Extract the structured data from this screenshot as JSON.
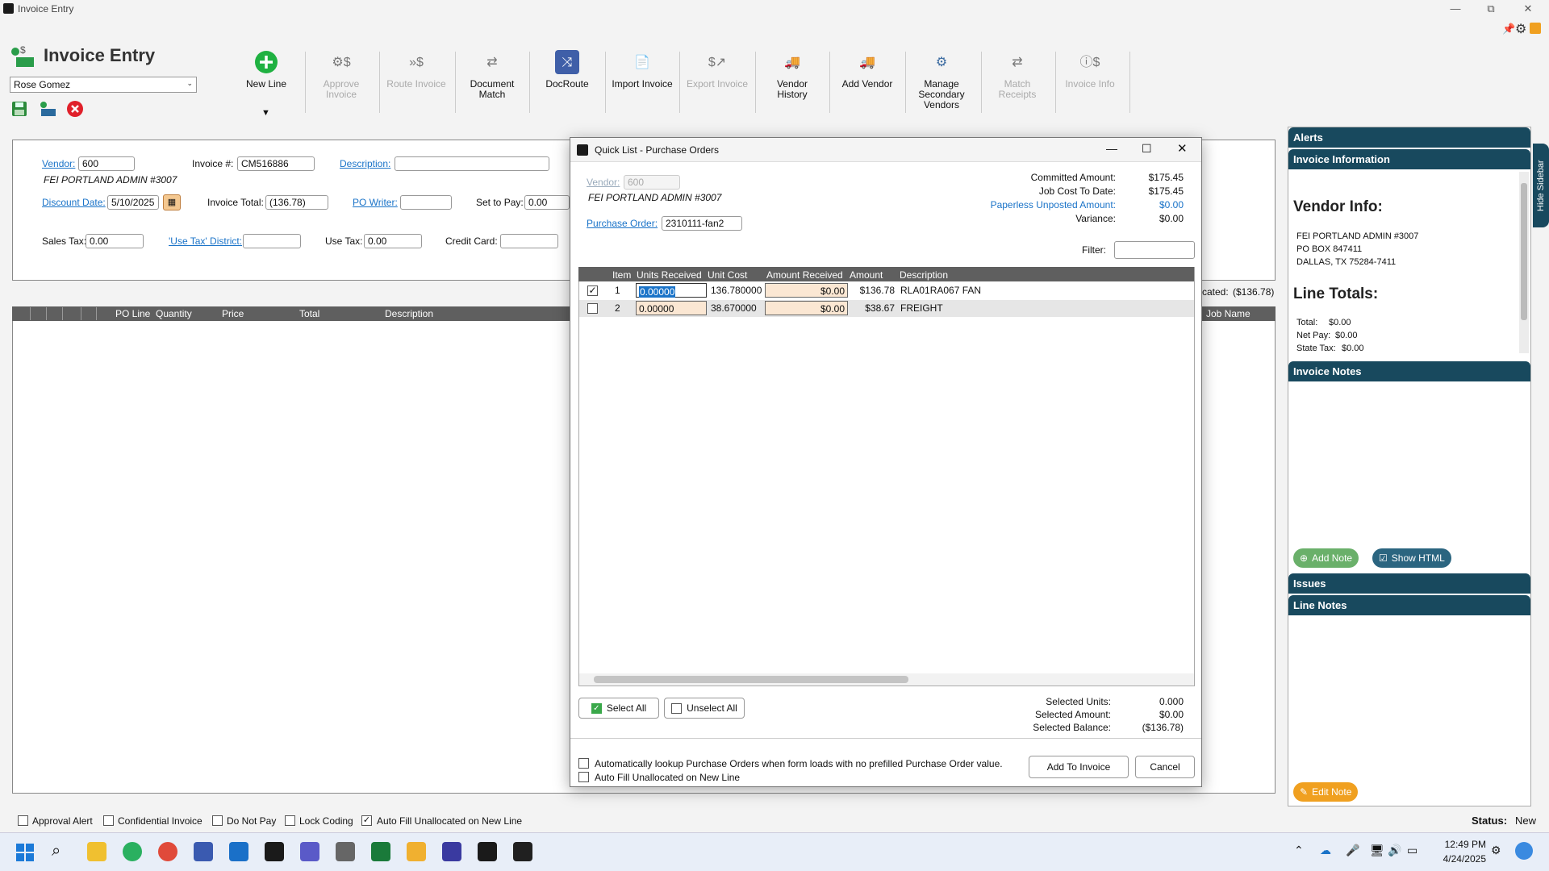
{
  "window": {
    "title": "Invoice Entry",
    "min": "—",
    "max": "⧉",
    "close": "✕"
  },
  "app": {
    "name": "Invoice Entry",
    "user": "Rose Gomez"
  },
  "toolbar": [
    {
      "id": "new-line",
      "label": "New Line",
      "enabled": true
    },
    {
      "id": "approve-invoice",
      "label": "Approve Invoice",
      "enabled": false
    },
    {
      "id": "route-invoice",
      "label": "Route Invoice",
      "enabled": false
    },
    {
      "id": "document-match",
      "label": "Document Match",
      "enabled": true
    },
    {
      "id": "docroute",
      "label": "DocRoute",
      "enabled": true
    },
    {
      "id": "import-invoice",
      "label": "Import Invoice",
      "enabled": true
    },
    {
      "id": "export-invoice",
      "label": "Export Invoice",
      "enabled": false
    },
    {
      "id": "vendor-history",
      "label": "Vendor History",
      "enabled": true
    },
    {
      "id": "add-vendor",
      "label": "Add Vendor",
      "enabled": true
    },
    {
      "id": "manage-secondary-vendors",
      "label": "Manage Secondary Vendors",
      "enabled": true
    },
    {
      "id": "match-receipts",
      "label": "Match Receipts",
      "enabled": false
    },
    {
      "id": "invoice-info",
      "label": "Invoice Info",
      "enabled": false
    }
  ],
  "newline_dropdown": "▼",
  "form": {
    "vendor_label": "Vendor:",
    "vendor_value": "600",
    "vendor_name": "FEI PORTLAND ADMIN #3007",
    "invoice_no_label": "Invoice #:",
    "invoice_no_value": "CM516886",
    "description_label": "Description:",
    "description_value": "",
    "discount_date_label": "Discount Date:",
    "discount_date_value": "5/10/2025",
    "invoice_total_label": "Invoice Total:",
    "invoice_total_value": "(136.78)",
    "po_writer_label": "PO Writer:",
    "po_writer_value": "",
    "set_to_pay_label": "Set to Pay:",
    "set_to_pay_value": "0.00",
    "sales_tax_label": "Sales Tax:",
    "sales_tax_value": "0.00",
    "use_tax_district_label": "'Use Tax' District:",
    "use_tax_district_value": "",
    "use_tax_label": "Use Tax:",
    "use_tax_value": "0.00",
    "credit_card_label": "Credit Card:",
    "credit_card_value": ""
  },
  "allocated_text": "cated:",
  "allocated_value": "($136.78)",
  "lines_grid": {
    "columns": [
      "PO Line",
      "Quantity",
      "Price",
      "Total",
      "Description"
    ],
    "right_column": "Job Name"
  },
  "dialog": {
    "title": "Quick List - Purchase Orders",
    "vendor_label": "Vendor:",
    "vendor_value": "600",
    "vendor_name": "FEI PORTLAND ADMIN #3007",
    "po_label": "Purchase Order:",
    "po_value": "2310111-fan2",
    "committed_label": "Committed Amount:",
    "committed_value": "$175.45",
    "jobcost_label": "Job Cost To Date:",
    "jobcost_value": "$175.45",
    "paperless_label": "Paperless Unposted Amount:",
    "paperless_value": "$0.00",
    "variance_label": "Variance:",
    "variance_value": "$0.00",
    "filter_label": "Filter:",
    "filter_value": "",
    "columns": [
      "Item",
      "Units Received",
      "Unit Cost",
      "Amount Received",
      "Amount",
      "Description"
    ],
    "rows": [
      {
        "checked": true,
        "item": "1",
        "units": "0.00000",
        "unit_cost": "136.780000",
        "amount_received": "$0.00",
        "amount": "$136.78",
        "description": "RLA01RA067 FAN"
      },
      {
        "checked": false,
        "item": "2",
        "units": "0.00000",
        "unit_cost": "38.670000",
        "amount_received": "$0.00",
        "amount": "$38.67",
        "description": "FREIGHT"
      }
    ],
    "select_all": "Select All",
    "unselect_all": "Unselect All",
    "sel_units_label": "Selected Units:",
    "sel_units_value": "0.000",
    "sel_amount_label": "Selected Amount:",
    "sel_amount_value": "$0.00",
    "sel_balance_label": "Selected Balance:",
    "sel_balance_value": "($136.78)",
    "auto_lookup": "Automatically lookup Purchase Orders when form loads with no prefilled Purchase Order value.",
    "auto_fill": "Auto Fill Unallocated on New Line",
    "add_to_invoice": "Add To Invoice",
    "cancel": "Cancel"
  },
  "sidebar": {
    "alerts": "Alerts",
    "invoice_information": "Invoice Information",
    "vendor_info_title": "Vendor Info:",
    "vendor_lines": [
      "FEI PORTLAND ADMIN #3007",
      "PO BOX 847411",
      "DALLAS, TX 75284-7411"
    ],
    "line_totals_title": "Line Totals:",
    "total_label": "Total:",
    "total_value": "$0.00",
    "netpay_label": "Net Pay:",
    "netpay_value": "$0.00",
    "statetax_label": "State Tax:",
    "statetax_value": "$0.00",
    "invoice_notes": "Invoice Notes",
    "add_note": "Add Note",
    "show_html": "Show HTML",
    "issues": "Issues",
    "line_notes": "Line Notes",
    "edit_note": "Edit Note",
    "hide_sidebar": "Hide Sidebar"
  },
  "bottom": {
    "approval_alert": "Approval Alert",
    "confidential_invoice": "Confidential Invoice",
    "do_not_pay": "Do Not Pay",
    "lock_coding": "Lock Coding",
    "auto_fill": "Auto Fill Unallocated on New Line",
    "status_label": "Status:",
    "status_value": "New"
  },
  "taskbar": {
    "time": "12:49 PM",
    "date": "4/24/2025"
  },
  "colors": {
    "accent": "#18495e",
    "link": "#1a73c8",
    "green": "#1fb141",
    "orange": "#f0a020",
    "grid_header": "#5f5f5f",
    "amount_cell": "#fbe7d3"
  }
}
